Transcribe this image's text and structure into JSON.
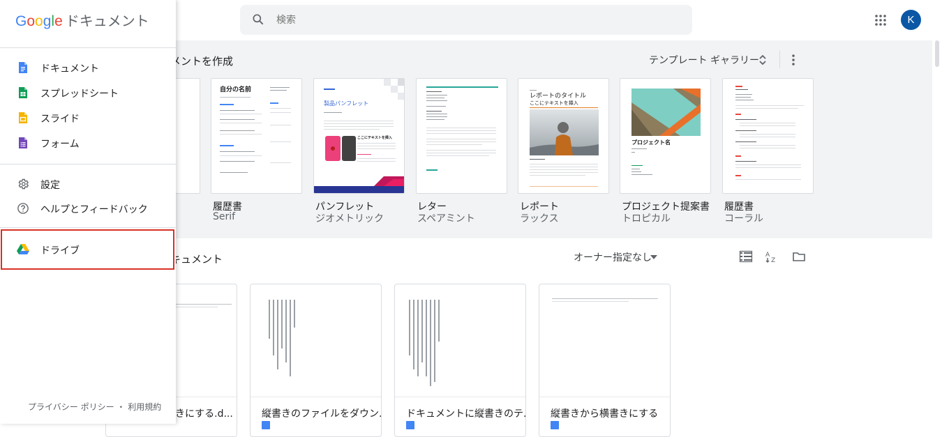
{
  "header": {
    "search_placeholder": "検索",
    "avatar_initial": "K"
  },
  "templates": {
    "heading": "メントを作成",
    "gallery_label": "テンプレート ギャラリー",
    "items": [
      {
        "name": "履歴書",
        "sub": "Serif",
        "thumb_title": "自分の名前"
      },
      {
        "name": "パンフレット",
        "sub": "ジオメトリック",
        "thumb_title": "製品パンフレット"
      },
      {
        "name": "レター",
        "sub": "スペアミント",
        "thumb_title": ""
      },
      {
        "name": "レポート",
        "sub": "ラックス",
        "thumb_title": "レポートのタイトル"
      },
      {
        "name": "プロジェクト提案書",
        "sub": "トロピカル",
        "thumb_title": "プロジェクト名"
      },
      {
        "name": "履歴書",
        "sub": "コーラル",
        "thumb_title": ""
      }
    ],
    "thumb_extra": {
      "report_subtitle": "ここにテキストを挿入",
      "brochure_section": "ここにテキストを挿入"
    }
  },
  "recent": {
    "heading": "キュメント",
    "owner_filter": "オーナー指定なし",
    "docs": [
      {
        "title": "書きにする.d..."
      },
      {
        "title": "縦書きのファイルをダウン..."
      },
      {
        "title": "ドキュメントに縦書きのテ..."
      },
      {
        "title": "縦書きから横書きにする"
      }
    ]
  },
  "drawer": {
    "logo_google": "Google",
    "logo_app": "ドキュメント",
    "apps": [
      {
        "label": "ドキュメント",
        "icon": "docs-icon"
      },
      {
        "label": "スプレッドシート",
        "icon": "sheets-icon"
      },
      {
        "label": "スライド",
        "icon": "slides-icon"
      },
      {
        "label": "フォーム",
        "icon": "forms-icon"
      }
    ],
    "settings_label": "設定",
    "help_label": "ヘルプとフィードバック",
    "drive_label": "ドライブ",
    "footer": "プライバシー ポリシー ・ 利用規約"
  },
  "colors": {
    "docs": "#4285f4",
    "sheets": "#0f9d58",
    "slides": "#f4b400",
    "forms": "#7248b9",
    "highlight": "#d93025",
    "avatar": "#0b57a6"
  }
}
